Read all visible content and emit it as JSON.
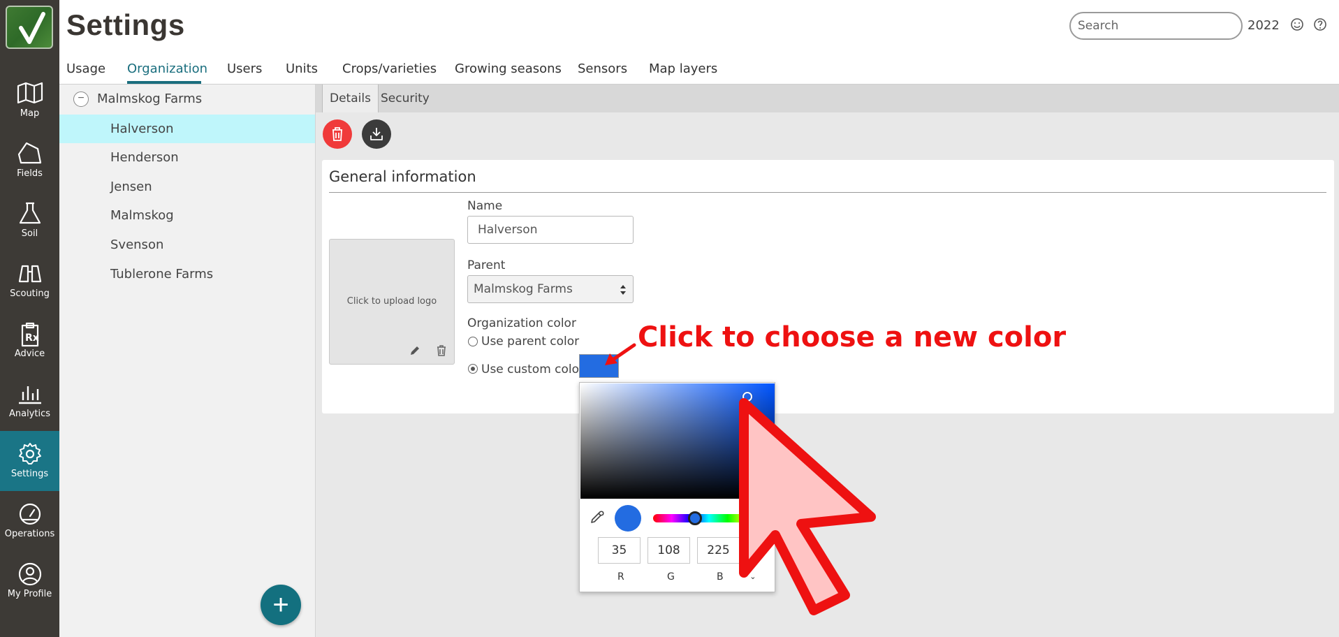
{
  "nav": {
    "items": [
      {
        "label": "Map"
      },
      {
        "label": "Fields"
      },
      {
        "label": "Soil"
      },
      {
        "label": "Scouting"
      },
      {
        "label": "Advice"
      },
      {
        "label": "Analytics"
      },
      {
        "label": "Settings"
      },
      {
        "label": "Operations"
      },
      {
        "label": "My Profile"
      }
    ],
    "active": "Settings",
    "active_color": "#1a7586"
  },
  "header": {
    "title": "Settings",
    "search_placeholder": "Search",
    "year": "2022"
  },
  "tabs": [
    {
      "label": "Usage"
    },
    {
      "label": "Organization"
    },
    {
      "label": "Users"
    },
    {
      "label": "Units"
    },
    {
      "label": "Crops/varieties"
    },
    {
      "label": "Growing seasons"
    },
    {
      "label": "Sensors"
    },
    {
      "label": "Map layers"
    }
  ],
  "active_tab": "Organization",
  "tree": {
    "root": "Malmskog Farms",
    "items": [
      {
        "label": "Halverson"
      },
      {
        "label": "Henderson"
      },
      {
        "label": "Jensen"
      },
      {
        "label": "Malmskog"
      },
      {
        "label": "Svenson"
      },
      {
        "label": "Tublerone Farms"
      }
    ],
    "selected": "Halverson",
    "add_label": "+"
  },
  "subtabs": [
    {
      "label": "Details"
    },
    {
      "label": "Security"
    }
  ],
  "active_subtab": "Details",
  "form": {
    "section_title": "General information",
    "logo_hint": "Click to upload logo",
    "name_label": "Name",
    "name_value": "Halverson",
    "parent_label": "Parent",
    "parent_value": "Malmskog Farms",
    "color_label": "Organization color",
    "use_parent_label": "Use parent color",
    "use_custom_label": "Use custom color",
    "selected_option": "Use custom color",
    "custom_color": "#236ce1"
  },
  "color_picker": {
    "r": "35",
    "g": "108",
    "b": "225",
    "r_label": "R",
    "g_label": "G",
    "b_label": "B",
    "mode_toggle": "⌃⌄"
  },
  "annotation": {
    "text": "Click to choose a new color",
    "color": "#ee1111"
  }
}
